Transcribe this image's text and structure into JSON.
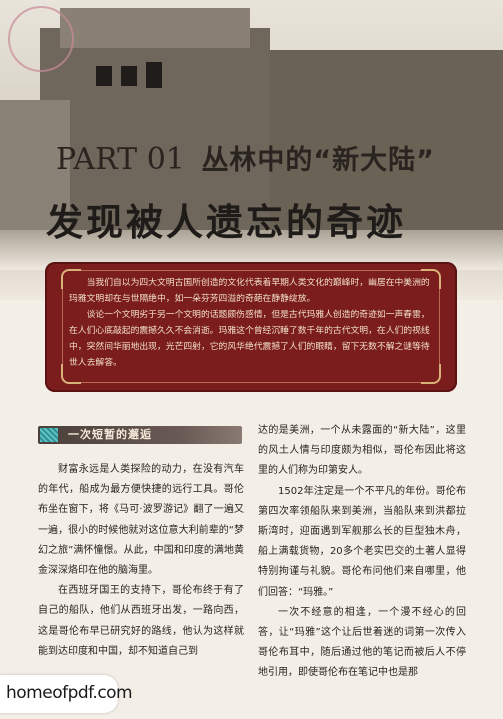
{
  "hero": {
    "stamp_text": "",
    "part_label_en": "PART 01",
    "part_label_cn": "丛林中的“新大陆”",
    "main_title": "发现被人遗忘的奇迹"
  },
  "intro": {
    "paragraphs": [
      "当我们自以为四大文明古国所创造的文化代表着早期人类文化的巅峰时，幽居在中美洲的玛雅文明却在与世隔绝中，如一朵芬芳四溢的奇葩在静静绽放。",
      "谈论一个文明劣于另一个文明的话题颇伤感情，但是古代玛雅人创造的奇迹如一声春雷，在人们心底敲起的震撼久久不会消逝。玛雅这个曾经沉睡了数千年的古代文明，在人们的视线中，突然间华丽地出现，光芒四射，它的风华绝代震撼了人们的眼睛，留下无数不解之谜等待世人去解答。"
    ]
  },
  "section": {
    "heading": "一次短暂的邂逅",
    "icon": "pattern-icon"
  },
  "left_column": [
    "财富永远是人类探险的动力，在没有汽车的年代，船成为最方便快捷的远行工具。哥伦布坐在窗下，将《马可·波罗游记》翻了一遍又一遍，很小的时候他就对这位意大利前辈的“梦幻之旅”满怀憧憬。从此，中国和印度的满地黄金深深烙印在他的脑海里。",
    "在西班牙国王的支持下，哥伦布终于有了自己的船队，他们从西班牙出发，一路向西，这是哥伦布早已研究好的路线，他认为这样就能到达印度和中国，却不知道自己到"
  ],
  "right_column": [
    "达的是美洲，一个从未露面的“新大陆”，这里的风土人情与印度颇为相似，哥伦布因此将这里的人们称为印第安人。",
    "1502年注定是一个不平凡的年份。哥伦布第四次率领船队来到美洲，当船队来到洪都拉斯湾时，迎面遇到军舰那么长的巨型独木舟，船上满载货物，20多个老实巴交的土著人显得特别拘谨与礼貌。哥伦布问他们来自哪里，他们回答：“玛雅。”",
    "一次不经意的相逢，一个漫不经心的回答，让“玛雅”这个让后世着迷的词第一次传入哥伦布耳中，随后通过他的笔记而被后人不停地引用，即使哥伦布在笔记中也是那"
  ],
  "watermark": "homeofpdf.com",
  "colors": {
    "intro_bg": "#7a1d1c",
    "heading_bg": "#4a3f3a",
    "text": "#2a2320"
  }
}
